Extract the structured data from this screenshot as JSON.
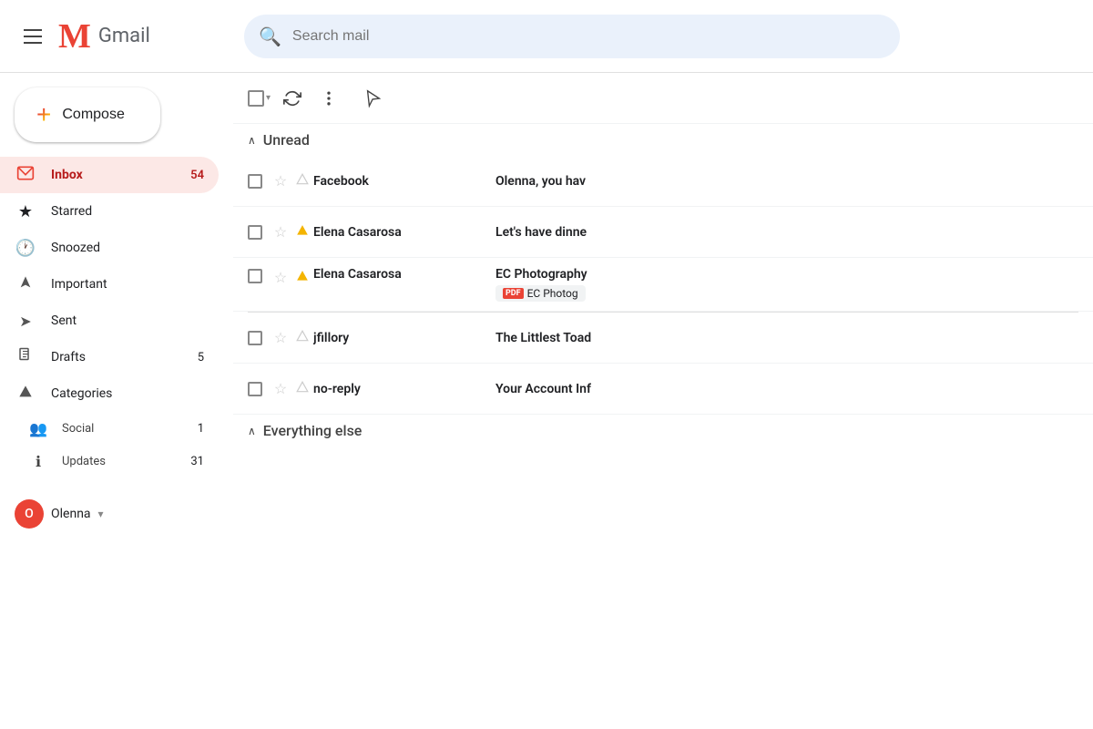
{
  "header": {
    "hamburger_label": "Menu",
    "gmail_m": "M",
    "gmail_text": "Gmail",
    "search_placeholder": "Search mail"
  },
  "sidebar": {
    "compose_label": "Compose",
    "nav_items": [
      {
        "id": "inbox",
        "icon": "📥",
        "label": "Inbox",
        "badge": "54",
        "active": true
      },
      {
        "id": "starred",
        "icon": "★",
        "label": "Starred",
        "badge": "",
        "active": false
      },
      {
        "id": "snoozed",
        "icon": "🕐",
        "label": "Snoozed",
        "badge": "",
        "active": false
      },
      {
        "id": "important",
        "icon": "▶",
        "label": "Important",
        "badge": "",
        "active": false
      },
      {
        "id": "sent",
        "icon": "➤",
        "label": "Sent",
        "badge": "",
        "active": false
      },
      {
        "id": "drafts",
        "icon": "📄",
        "label": "Drafts",
        "badge": "5",
        "active": false
      },
      {
        "id": "categories",
        "icon": "▶",
        "label": "Categories",
        "badge": "",
        "active": false
      }
    ],
    "sub_items": [
      {
        "id": "social",
        "icon": "👥",
        "label": "Social",
        "badge": "1"
      },
      {
        "id": "updates",
        "icon": "ℹ",
        "label": "Updates",
        "badge": "31"
      }
    ],
    "user_name": "Olenna",
    "user_initial": "O"
  },
  "toolbar": {
    "select_all_label": "Select all"
  },
  "sections": {
    "unread": {
      "label": "Unread",
      "caret": "∧"
    },
    "everything_else": {
      "label": "Everything else",
      "caret": "∧"
    }
  },
  "emails": {
    "unread": [
      {
        "id": "fb",
        "sender": "Facebook",
        "subject": "Olenna, you hav",
        "preview": "Olenna, you hav...",
        "starred": false,
        "important": false,
        "time": "",
        "attachment": null
      },
      {
        "id": "ec1",
        "sender": "Elena Casarosa",
        "subject": "Let's have dinne",
        "preview": "Let's have dinner...",
        "starred": false,
        "important": true,
        "time": "",
        "attachment": null
      },
      {
        "id": "ec2",
        "sender": "Elena Casarosa",
        "subject": "EC Photography",
        "preview": "EC Photography",
        "starred": false,
        "important": true,
        "time": "",
        "attachment": {
          "type": "pdf",
          "label": "EC Photog"
        }
      }
    ],
    "everything_else": [
      {
        "id": "jfillory",
        "sender": "jfillory",
        "subject": "The Littlest Toad",
        "preview": "The Littlest Toad...",
        "starred": false,
        "important": false,
        "time": "",
        "attachment": null
      },
      {
        "id": "noreply",
        "sender": "no-reply",
        "subject": "Your Account Inf",
        "preview": "Your Account Info...",
        "starred": false,
        "important": false,
        "time": "",
        "attachment": null
      }
    ]
  }
}
